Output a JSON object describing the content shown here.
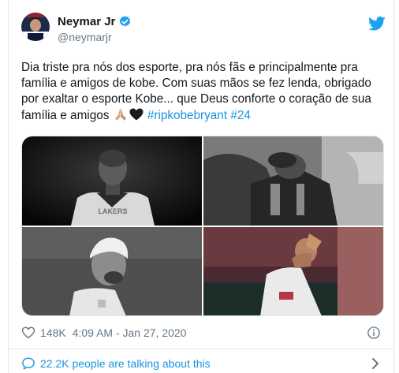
{
  "author": {
    "display_name": "Neymar Jr",
    "handle": "@neymarjr",
    "verified": true
  },
  "tweet": {
    "text_main": "Dia triste pra nós dos esporte, pra nós fãs e principalmente pra família e amigos de kobe. Com suas mãos se fez lenda, obrigado por exaltar o esporte Kobe... que Deus conforte o coração de sua família e amigos ",
    "emojis": [
      "praying-hands",
      "black-heart"
    ],
    "hashtags": [
      "#ripkobebryant",
      "#24"
    ]
  },
  "media": {
    "photos": [
      {
        "name": "photo-kobe-portrait",
        "subject": "Kobe Bryant in Lakers jersey, black and white"
      },
      {
        "name": "photo-neymar-head-down",
        "subject": "Neymar with head lowered, black and white"
      },
      {
        "name": "photo-neymar-bleached-hair",
        "subject": "Neymar with bleached hair, black and white"
      },
      {
        "name": "photo-neymar-gesture",
        "subject": "Neymar making a gesture on the pitch"
      }
    ],
    "jersey_text": "LAKERS"
  },
  "engagement": {
    "likes": "148K",
    "timestamp": "4:09 AM - Jan 27, 2020",
    "talking": "22.2K people are talking about this"
  },
  "colors": {
    "accent": "#1b95e0",
    "text": "#14171a",
    "secondary": "#657786",
    "border": "#e1e8ed",
    "verified": "#1da1f2"
  },
  "icons": {
    "brand": "twitter-bird-icon",
    "like": "heart-icon",
    "info": "info-icon",
    "conversation": "speech-bubble-icon",
    "more": "chevron-right-icon"
  }
}
